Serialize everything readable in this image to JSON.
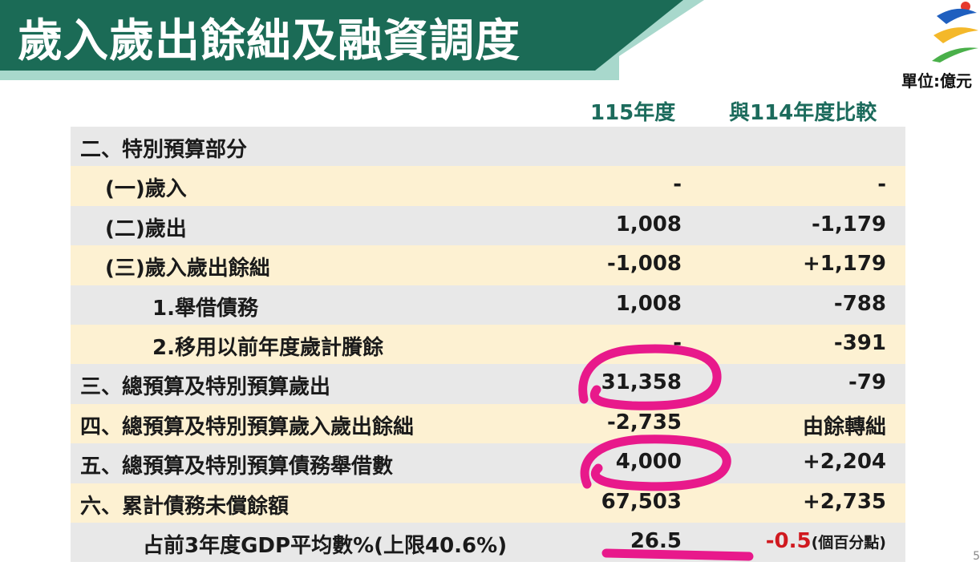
{
  "title": "歲入歲出餘絀及融資調度",
  "unit": "單位:億元",
  "columns": {
    "year": "115年度",
    "compare": "與114年度比較"
  },
  "rows": [
    {
      "label": "二、特別預算部分",
      "v1": "",
      "v2": ""
    },
    {
      "label": "(一)歲入",
      "v1": "-",
      "v2": "-"
    },
    {
      "label": "(二)歲出",
      "v1": "1,008",
      "v2": "-1,179"
    },
    {
      "label": "(三)歲入歲出餘絀",
      "v1": "-1,008",
      "v2": "+1,179"
    },
    {
      "label": "1.舉借債務",
      "v1": "1,008",
      "v2": "-788"
    },
    {
      "label": "2.移用以前年度歲計賸餘",
      "v1": "-",
      "v2": "-391"
    },
    {
      "label": "三、總預算及特別預算歲出",
      "v1": "31,358",
      "v2": "-79"
    },
    {
      "label": "四、總預算及特別預算歲入歲出餘絀",
      "v1": "-2,735",
      "v2": "由餘轉絀"
    },
    {
      "label": "五、總預算及特別預算債務舉借數",
      "v1": "4,000",
      "v2": "+2,204"
    },
    {
      "label": "六、累計債務未償餘額",
      "v1": "67,503",
      "v2": "+2,735"
    },
    {
      "label": "占前3年度GDP平均數%(上限40.6%)",
      "v1": "26.5",
      "v2": "-0.5",
      "v2_suffix": "(個百分點)"
    }
  ],
  "page_number": "5",
  "colors": {
    "banner": "#1b6b56",
    "accent": "#a8d8cc",
    "highlight": "#e8198b"
  }
}
